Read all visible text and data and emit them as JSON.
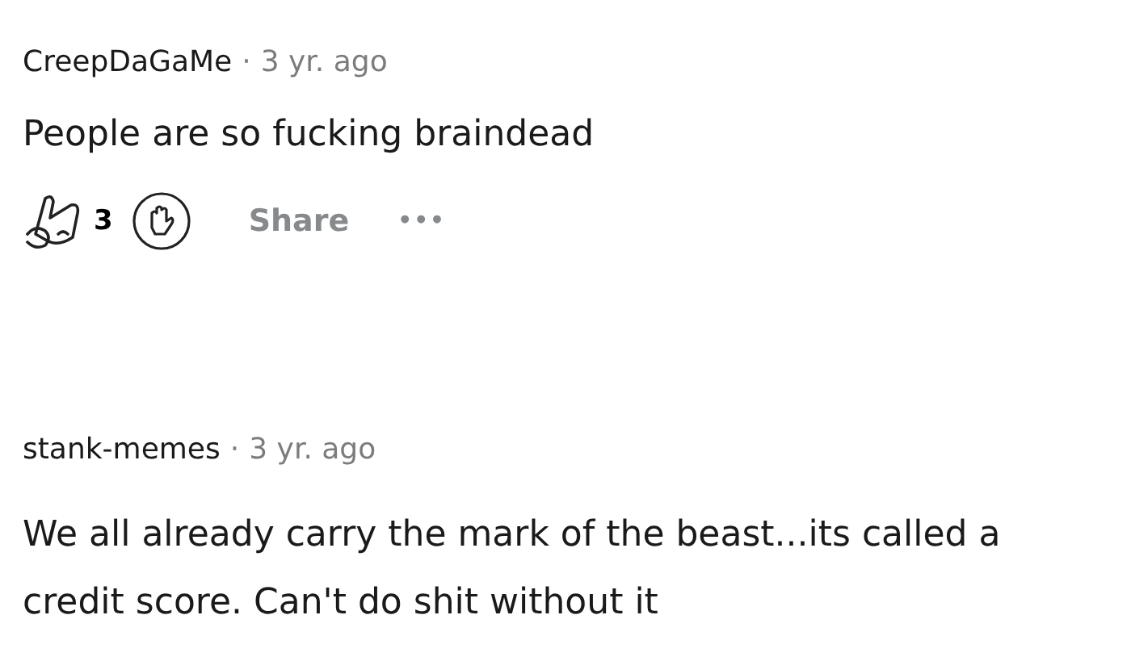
{
  "comments": [
    {
      "author": "CreepDaGaMe",
      "separator": "·",
      "time": "3 yr. ago",
      "body": "People are so fucking braindead",
      "actions": {
        "score": "3",
        "share": "Share",
        "more": "•••"
      }
    },
    {
      "author": "stank-memes",
      "separator": "·",
      "time": "3 yr. ago",
      "body": "We all already carry the mark of the beast...its called a credit score. Can't do shit without it"
    }
  ]
}
